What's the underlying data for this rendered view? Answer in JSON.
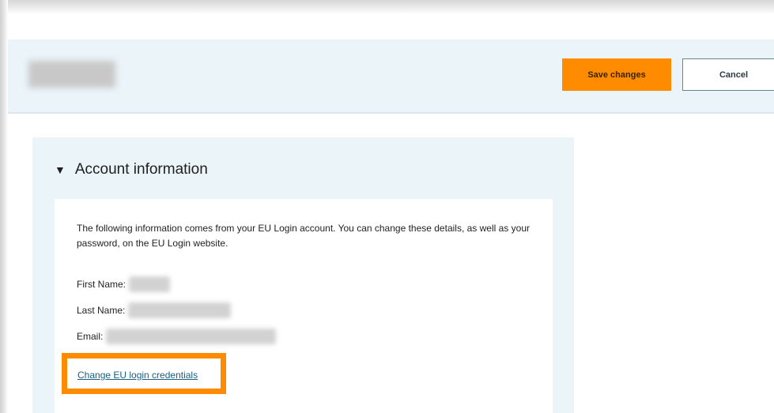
{
  "header": {
    "page_title": "",
    "save_label": "Save changes",
    "cancel_label": "Cancel"
  },
  "account_panel": {
    "caret": "▼",
    "title": "Account information",
    "intro": "The following information comes from your EU Login account. You can change these details, as well as your password, on the EU Login website.",
    "fields": [
      {
        "label": "First Name:",
        "value": ""
      },
      {
        "label": "Last Name:",
        "value": ""
      },
      {
        "label": "Email:",
        "value": ""
      }
    ],
    "change_link": "Change EU login credentials"
  },
  "colors": {
    "accent_orange": "#ff8c00",
    "panel_bg": "#eaf4f9",
    "link": "#1a5e86"
  }
}
